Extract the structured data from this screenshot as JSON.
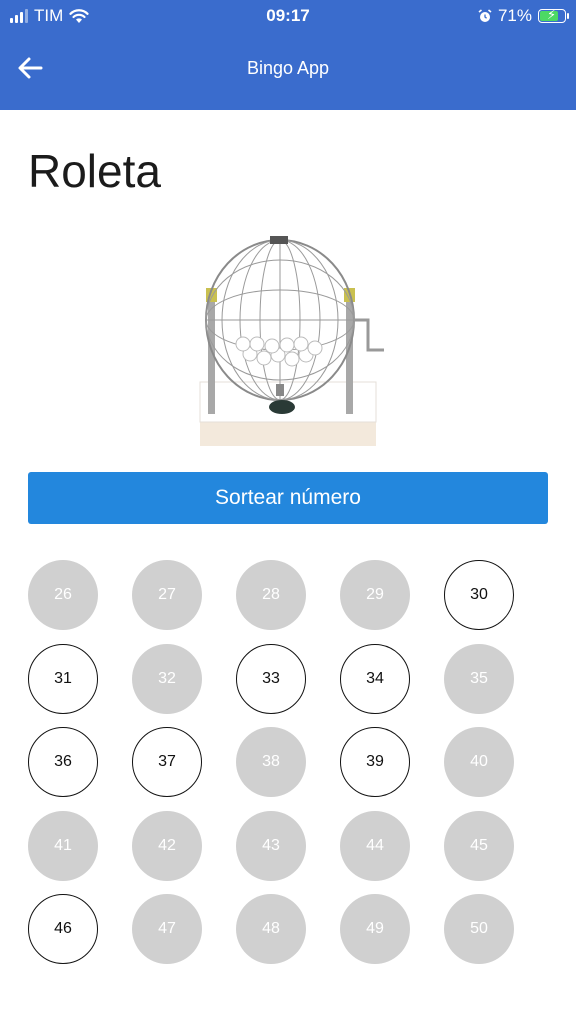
{
  "status_bar": {
    "carrier": "TIM",
    "time": "09:17",
    "battery": "71%"
  },
  "header": {
    "title": "Bingo App"
  },
  "page": {
    "title": "Roleta"
  },
  "actions": {
    "draw_label": "Sortear número"
  },
  "balls": [
    {
      "n": "26",
      "drawn": false
    },
    {
      "n": "27",
      "drawn": false
    },
    {
      "n": "28",
      "drawn": false
    },
    {
      "n": "29",
      "drawn": false
    },
    {
      "n": "30",
      "drawn": true
    },
    {
      "n": "31",
      "drawn": true
    },
    {
      "n": "32",
      "drawn": false
    },
    {
      "n": "33",
      "drawn": true
    },
    {
      "n": "34",
      "drawn": true
    },
    {
      "n": "35",
      "drawn": false
    },
    {
      "n": "36",
      "drawn": true
    },
    {
      "n": "37",
      "drawn": true
    },
    {
      "n": "38",
      "drawn": false
    },
    {
      "n": "39",
      "drawn": true
    },
    {
      "n": "40",
      "drawn": false
    },
    {
      "n": "41",
      "drawn": false
    },
    {
      "n": "42",
      "drawn": false
    },
    {
      "n": "43",
      "drawn": false
    },
    {
      "n": "44",
      "drawn": false
    },
    {
      "n": "45",
      "drawn": false
    },
    {
      "n": "46",
      "drawn": true
    },
    {
      "n": "47",
      "drawn": false
    },
    {
      "n": "48",
      "drawn": false
    },
    {
      "n": "49",
      "drawn": false
    },
    {
      "n": "50",
      "drawn": false
    }
  ],
  "colors": {
    "header": "#3a6ccd",
    "button": "#2387dd",
    "ball_inactive": "#d0d0d0",
    "ball_active_border": "#111111"
  }
}
